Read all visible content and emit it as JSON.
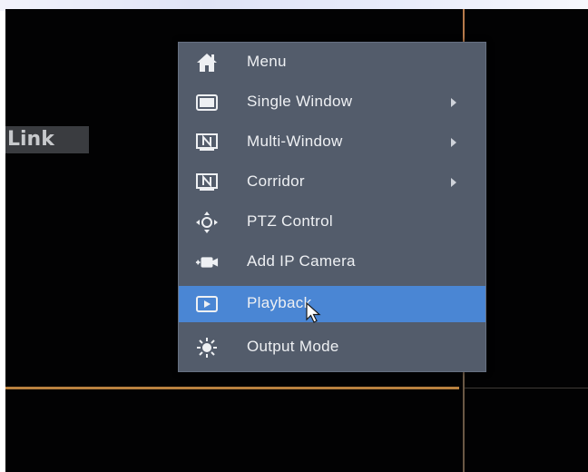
{
  "link_label": "Link",
  "menu": {
    "items": [
      {
        "label": "Menu",
        "icon": "home-icon",
        "submenu": false
      },
      {
        "label": "Single Window",
        "icon": "single-window-icon",
        "submenu": true
      },
      {
        "label": "Multi-Window",
        "icon": "multi-window-icon",
        "submenu": true
      },
      {
        "label": "Corridor",
        "icon": "corridor-icon",
        "submenu": true
      },
      {
        "label": "PTZ Control",
        "icon": "ptz-icon",
        "submenu": false
      },
      {
        "label": "Add IP Camera",
        "icon": "add-camera-icon",
        "submenu": false
      },
      {
        "label": "Playback",
        "icon": "playback-icon",
        "submenu": false,
        "highlighted": true
      },
      {
        "label": "Output Mode",
        "icon": "output-mode-icon",
        "submenu": false
      }
    ]
  },
  "colors": {
    "menu_bg": "#535c6b",
    "highlight": "#4a86d4",
    "divider_line": "#b9813f"
  }
}
